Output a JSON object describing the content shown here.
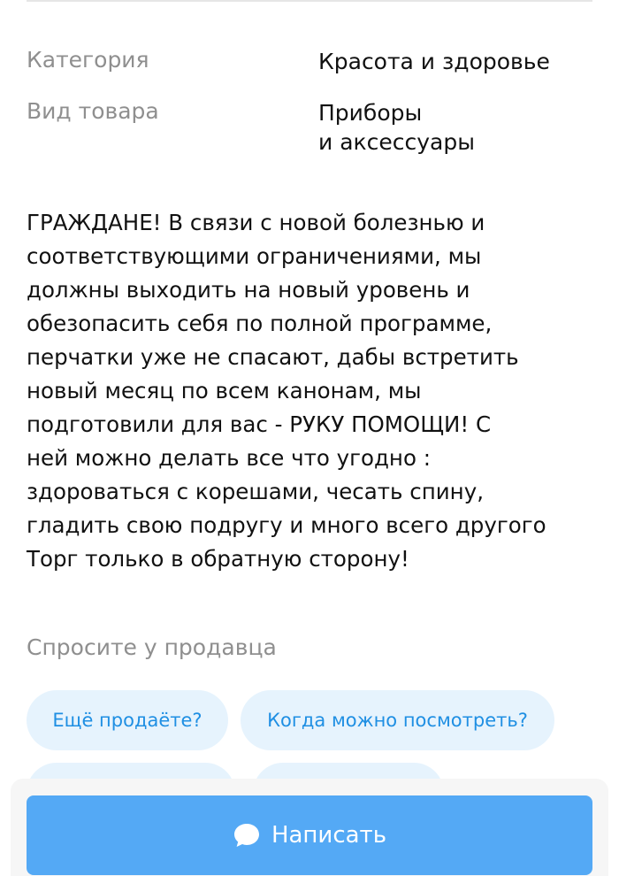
{
  "properties": [
    {
      "label": "Категория",
      "value_lines": [
        "Красота и здоровье"
      ]
    },
    {
      "label": "Вид товара",
      "value_lines": [
        "Приборы",
        "и аксессуары"
      ]
    }
  ],
  "description_lines": [
    "ГРАЖДАНЕ! В связи с новой болезнью и",
    "соответствующими ограничениями, мы",
    "должны выходить на новый уровень и",
    "обезопасить себя по полной программе,",
    "перчатки уже не спасают, дабы встретить",
    "новый месяц по всем канонам, мы",
    "подготовили для вас - РУКУ ПОМОЩИ! С",
    "ней можно делать все что угодно :",
    "здороваться с корешами, чесать спину,",
    "гладить свою подругу и много всего другого",
    "Торг только в обратную сторону!"
  ],
  "ask_seller": {
    "title": "Спросите у продавца",
    "chips": [
      "Ещё продаёте?",
      "Когда можно посмотреть?",
      "",
      ""
    ]
  },
  "write_button": {
    "label": "Написать",
    "icon": "chat-bubble-icon"
  },
  "colors": {
    "accent": "#54a9f5",
    "chip_bg": "#e6f3fd",
    "chip_text": "#1f8fe3",
    "muted_text": "#8f8f8f"
  }
}
